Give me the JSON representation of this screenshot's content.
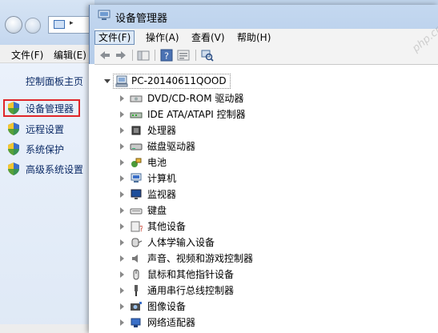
{
  "background_window": {
    "menu": [
      "文件(F)",
      "编辑(E)"
    ],
    "links": {
      "home": "控制面板主页",
      "items": [
        "设备管理器",
        "远程设置",
        "系统保护",
        "高级系统设置"
      ]
    }
  },
  "device_manager": {
    "title": "设备管理器",
    "menu": [
      "文件(F)",
      "操作(A)",
      "查看(V)",
      "帮助(H)"
    ],
    "toolbar_icons": [
      "back-arrow-icon",
      "forward-arrow-icon",
      "show-hide-tree-icon",
      "help-icon",
      "properties-icon",
      "scan-hardware-icon"
    ],
    "tree": {
      "root": "PC-20140611QOOD",
      "items": [
        {
          "label": "DVD/CD-ROM 驱动器",
          "icon": "dvd-drive-icon"
        },
        {
          "label": "IDE ATA/ATAPI 控制器",
          "icon": "ide-controller-icon"
        },
        {
          "label": "处理器",
          "icon": "processor-icon"
        },
        {
          "label": "磁盘驱动器",
          "icon": "disk-drive-icon"
        },
        {
          "label": "电池",
          "icon": "battery-icon"
        },
        {
          "label": "计算机",
          "icon": "computer-icon"
        },
        {
          "label": "监视器",
          "icon": "monitor-icon"
        },
        {
          "label": "键盘",
          "icon": "keyboard-icon"
        },
        {
          "label": "其他设备",
          "icon": "other-devices-icon"
        },
        {
          "label": "人体学输入设备",
          "icon": "hid-icon"
        },
        {
          "label": "声音、视频和游戏控制器",
          "icon": "sound-icon"
        },
        {
          "label": "鼠标和其他指针设备",
          "icon": "mouse-icon"
        },
        {
          "label": "通用串行总线控制器",
          "icon": "usb-icon"
        },
        {
          "label": "图像设备",
          "icon": "imaging-icon"
        },
        {
          "label": "网络适配器",
          "icon": "network-adapter-icon"
        }
      ]
    }
  },
  "colors": {
    "highlight": "#e0262a",
    "link": "#0b2a66"
  }
}
